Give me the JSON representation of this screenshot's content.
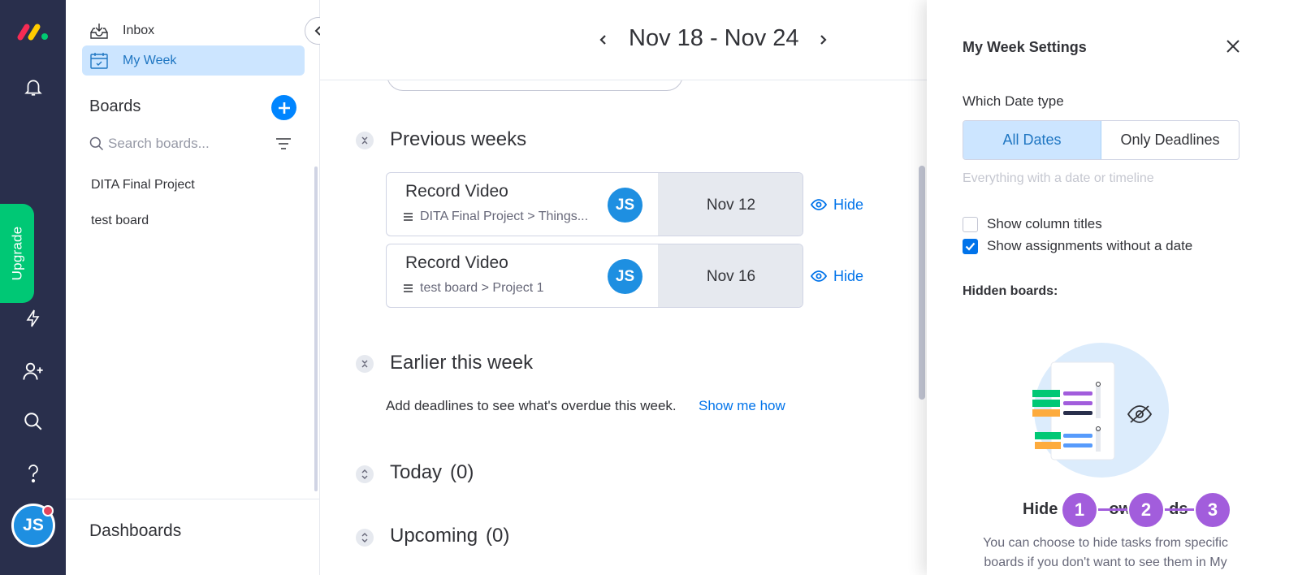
{
  "rail": {
    "upgrade_label": "Upgrade",
    "user_initials": "JS"
  },
  "sidebar": {
    "nav": [
      {
        "label": "Inbox",
        "icon": "inbox-icon"
      },
      {
        "label": "My Week",
        "icon": "calendar-icon",
        "active": true
      }
    ],
    "boards_title": "Boards",
    "search_placeholder": "Search boards...",
    "boards": [
      "DITA Final Project",
      "test board"
    ],
    "dashboards_title": "Dashboards"
  },
  "main": {
    "week_range": "Nov 18 - Nov 24",
    "sections": {
      "previous": {
        "title": "Previous weeks"
      },
      "earlier": {
        "title": "Earlier this week",
        "empty_text": "Add deadlines to see what's overdue this week.",
        "link": "Show me how"
      },
      "today": {
        "title": "Today",
        "count": "(0)"
      },
      "upcoming": {
        "title": "Upcoming",
        "count": "(0)"
      }
    },
    "tasks": [
      {
        "name": "Record Video",
        "path": "DITA Final Project > Things...",
        "assignee": "JS",
        "date": "Nov 12",
        "hide_label": "Hide"
      },
      {
        "name": "Record Video",
        "path": "test board > Project 1",
        "assignee": "JS",
        "date": "Nov 16",
        "hide_label": "Hide"
      }
    ]
  },
  "panel": {
    "title": "My Week Settings",
    "date_type_label": "Which Date type",
    "date_type_options": [
      "All Dates",
      "Only Deadlines"
    ],
    "date_type_selected": "All Dates",
    "date_type_desc": "Everything with a date or timeline",
    "checkboxes": [
      {
        "label": "Show column titles",
        "checked": false
      },
      {
        "label": "Show assignments without a date",
        "checked": true
      }
    ],
    "hidden_boards_label": "Hidden boards:",
    "hide_title": "Hide",
    "hide_title_tail": "ow",
    "hide_title_end": "ds",
    "hide_desc": "You can choose to hide tasks from specific boards if you don't want to see them in My"
  },
  "steps": [
    "1",
    "2",
    "3"
  ],
  "colors": {
    "rail_bg": "#292f4c",
    "accent": "#0073ea",
    "selected_bg": "#cce5ff",
    "upgrade": "#00c875",
    "step_marker": "#a25ddc",
    "avatar": "#1e8fe1"
  }
}
